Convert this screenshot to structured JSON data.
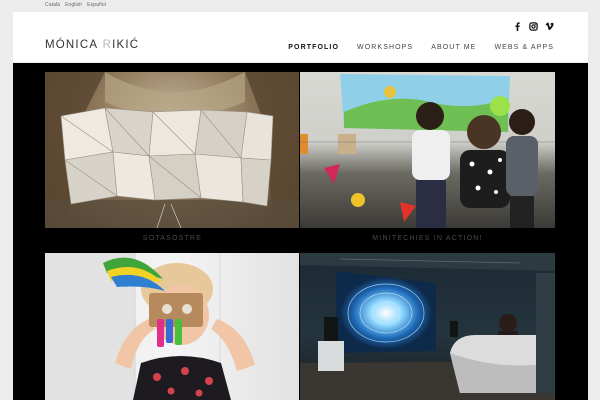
{
  "languages": [
    "Català",
    "English",
    "Español"
  ],
  "site": {
    "logo_main": "MÓNICA",
    "logo_light": "R",
    "logo_rest": "IKIĆ"
  },
  "social": [
    "facebook-icon",
    "instagram-icon",
    "vimeo-icon"
  ],
  "nav": [
    {
      "label": "PORTFOLIO",
      "active": true
    },
    {
      "label": "WORKSHOPS",
      "active": false
    },
    {
      "label": "ABOUT ME",
      "active": false
    },
    {
      "label": "WEBS & APPS",
      "active": false
    }
  ],
  "portfolio": [
    {
      "caption": "SOTASOSTRE"
    },
    {
      "caption": "MINITECHIES IN ACTION!"
    },
    {
      "caption": ""
    },
    {
      "caption": ""
    }
  ],
  "colors": {
    "page_bg": "#ececec",
    "header_bg": "#ffffff",
    "content_bg": "#000000",
    "caption_text": "#4a4a4a"
  }
}
